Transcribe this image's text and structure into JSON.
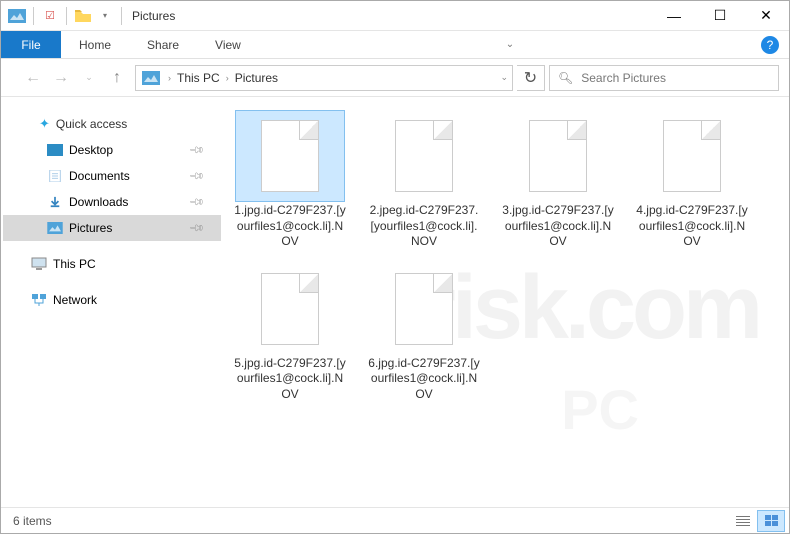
{
  "titlebar": {
    "title": "Pictures"
  },
  "ribbon": {
    "file": "File",
    "tabs": [
      "Home",
      "Share",
      "View"
    ]
  },
  "breadcrumb": {
    "parts": [
      "This PC",
      "Pictures"
    ]
  },
  "search": {
    "placeholder": "Search Pictures"
  },
  "sidebar": {
    "quick_access": "Quick access",
    "items": [
      {
        "label": "Desktop",
        "pinned": true
      },
      {
        "label": "Documents",
        "pinned": true
      },
      {
        "label": "Downloads",
        "pinned": true
      },
      {
        "label": "Pictures",
        "pinned": true,
        "selected": true
      }
    ],
    "this_pc": "This PC",
    "network": "Network"
  },
  "files": [
    {
      "name": "1.jpg.id-C279F237.[yourfiles1@cock.li].NOV",
      "selected": true
    },
    {
      "name": "2.jpeg.id-C279F237.[yourfiles1@cock.li].NOV"
    },
    {
      "name": "3.jpg.id-C279F237.[yourfiles1@cock.li].NOV"
    },
    {
      "name": "4.jpg.id-C279F237.[yourfiles1@cock.li].NOV"
    },
    {
      "name": "5.jpg.id-C279F237.[yourfiles1@cock.li].NOV"
    },
    {
      "name": "6.jpg.id-C279F237.[yourfiles1@cock.li].NOV"
    }
  ],
  "statusbar": {
    "count_label": "6 items"
  }
}
